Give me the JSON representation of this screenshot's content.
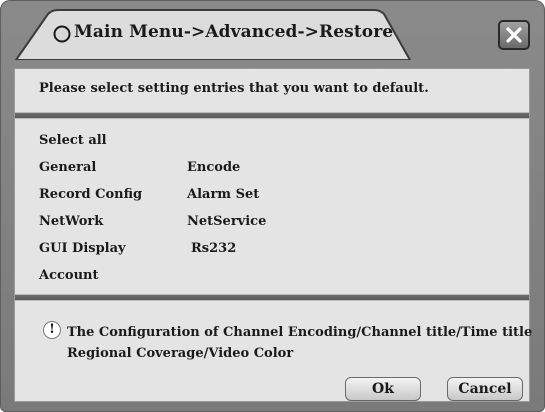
{
  "window": {
    "title": "Main Menu->Advanced->Restore",
    "close_label": "×"
  },
  "prompt": "Please  select setting entries that you want to default.",
  "options": {
    "select_all": "Select all",
    "left": [
      "General",
      "Record Config",
      "NetWork",
      "GUI Display",
      "Account"
    ],
    "right": [
      "Encode",
      "Alarm Set",
      "NetService",
      "Rs232"
    ]
  },
  "note": {
    "icon": "!",
    "line1": "The Configuration of Channel Encoding/Channel title/Time title",
    "line2": "Regional Coverage/Video Color"
  },
  "buttons": {
    "ok": "Ok",
    "cancel": "Cancel"
  },
  "colors": {
    "frame": "#7f7f7f",
    "panel": "#e4e4e4",
    "divider": "#626262",
    "text": "#1a1a1a"
  }
}
